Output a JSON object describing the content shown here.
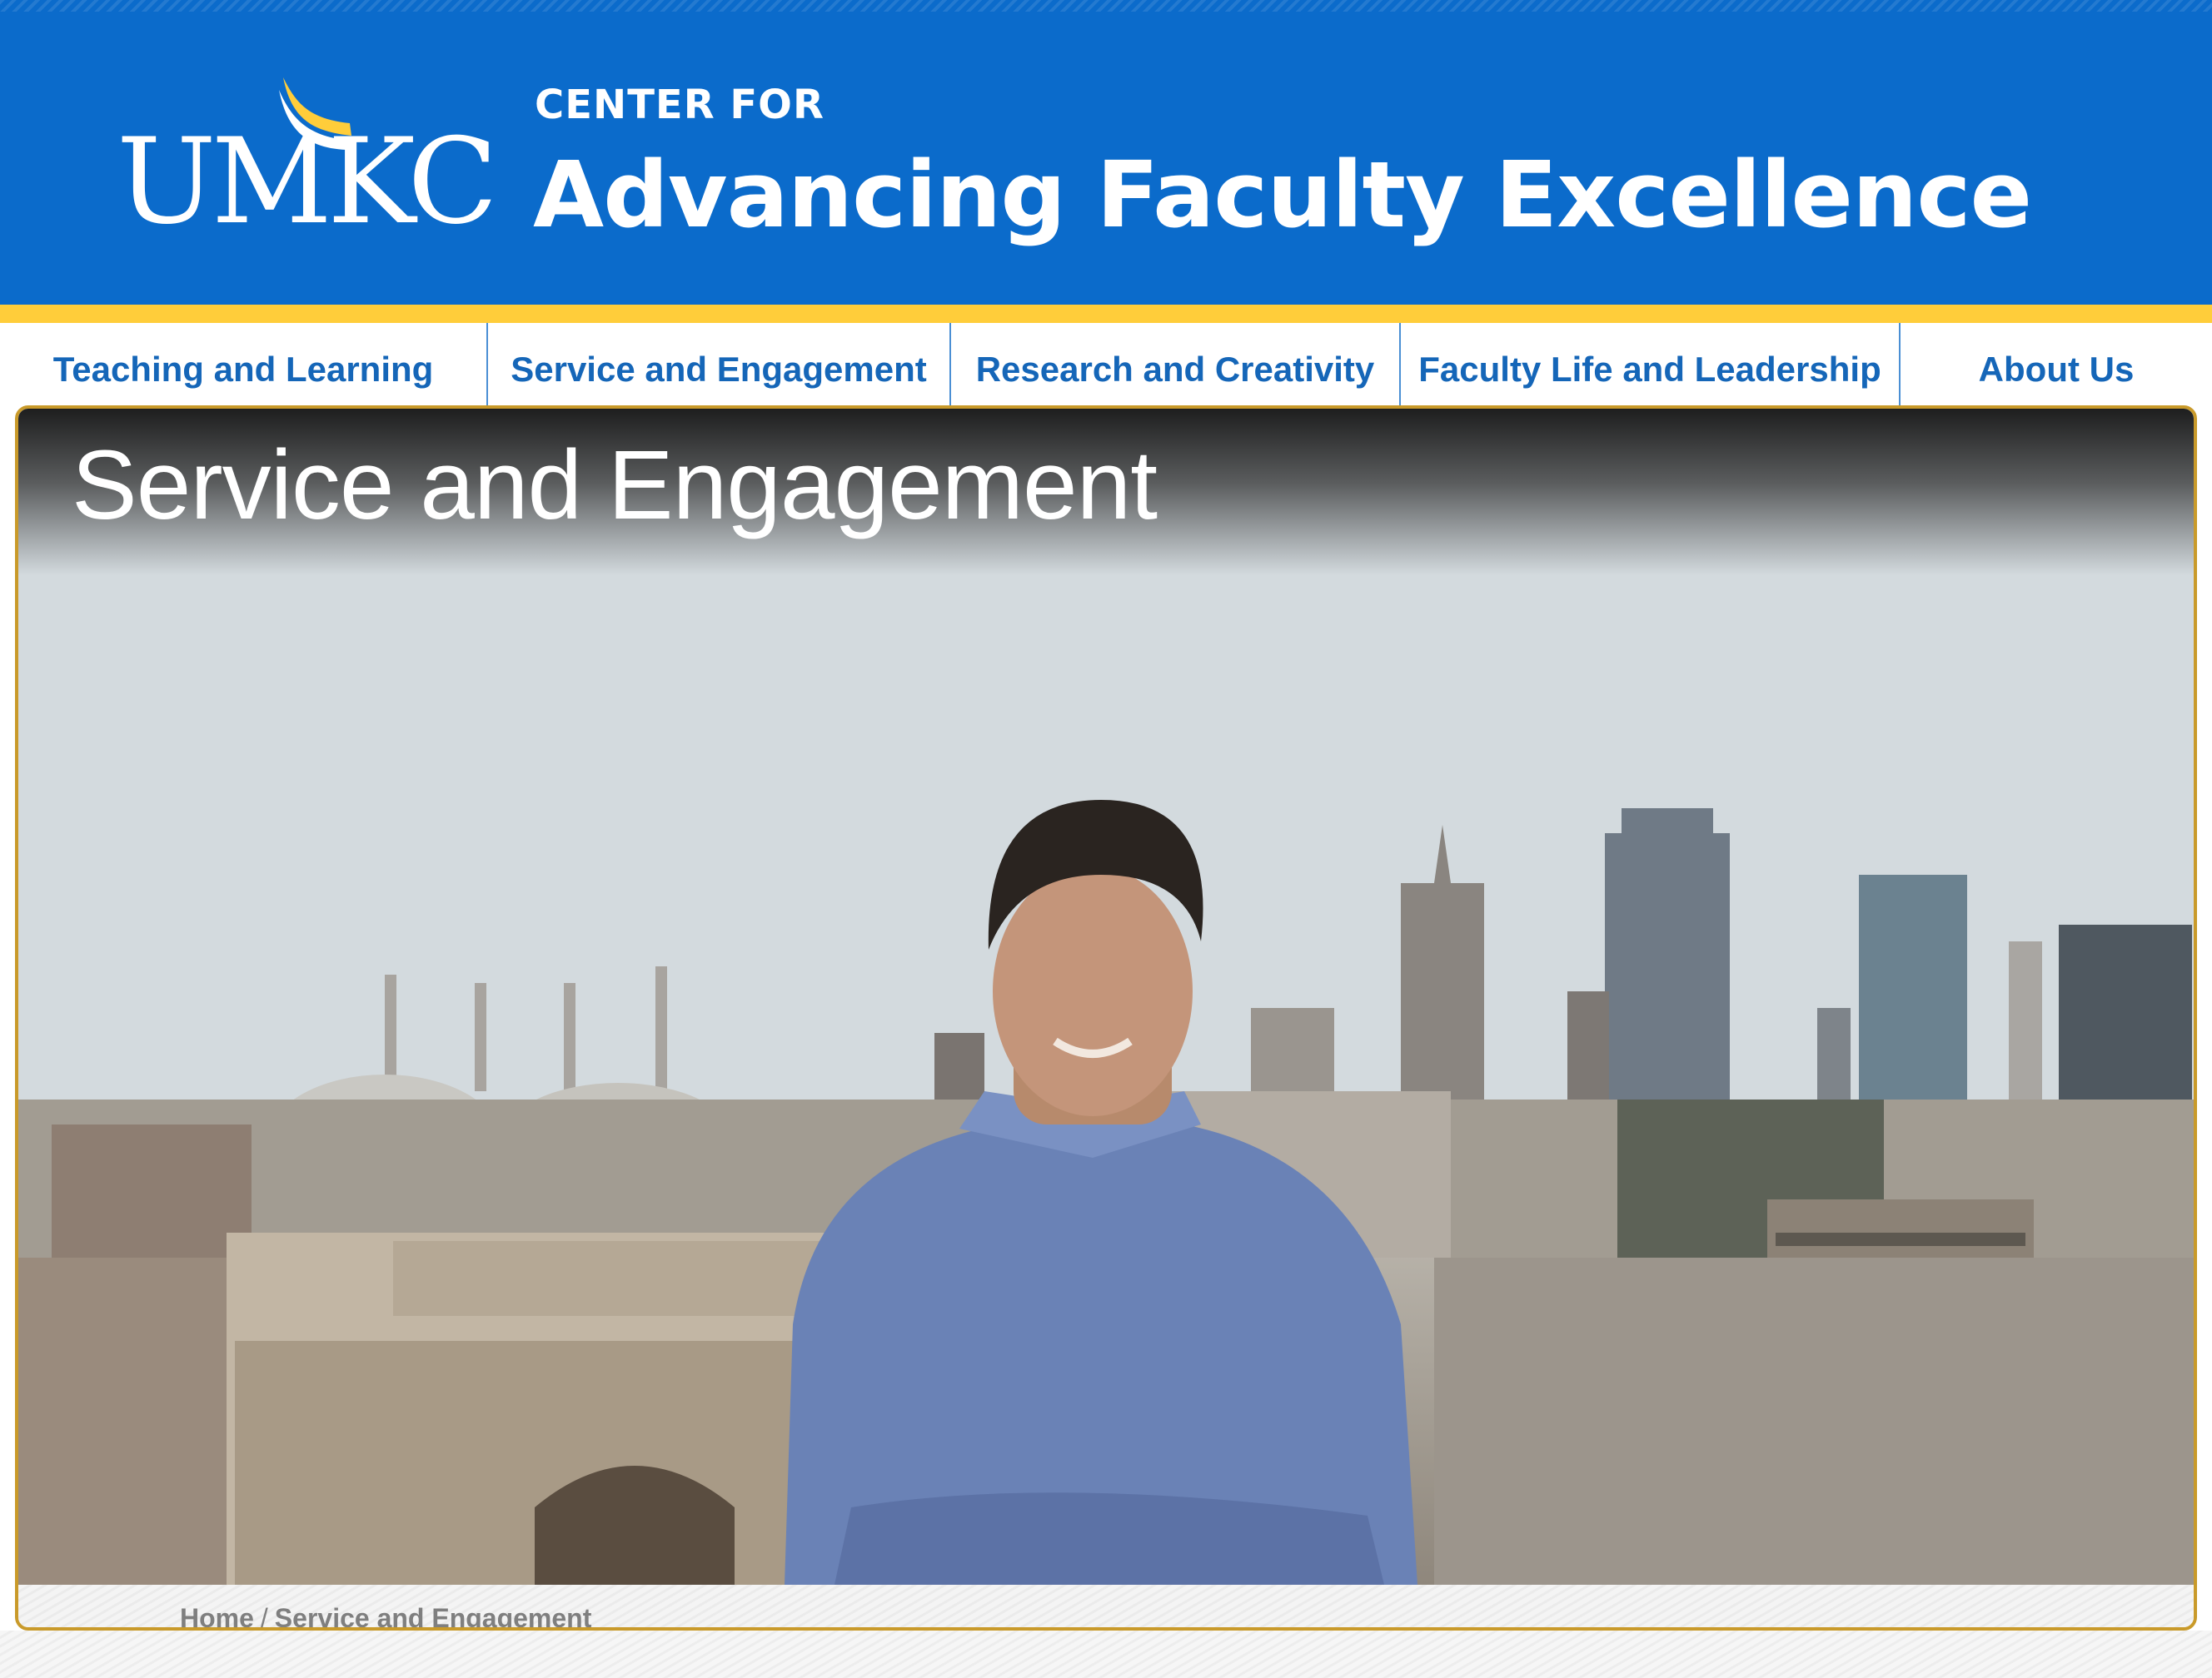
{
  "header": {
    "logo_text": "UMKC",
    "kicker": "CENTER FOR",
    "title": "Advancing Faculty Excellence"
  },
  "nav": {
    "items": [
      {
        "label": "Teaching and Learning"
      },
      {
        "label": "Service and Engagement"
      },
      {
        "label": "Research and Creativity"
      },
      {
        "label": "Faculty Life and Leadership"
      },
      {
        "label": "About Us"
      }
    ]
  },
  "hero": {
    "title": "Service and Engagement",
    "image_subject": "Student with arms crossed in front of a city skyline"
  },
  "breadcrumb": {
    "home": "Home",
    "separator": "/",
    "current": "Service and Engagement"
  },
  "colors": {
    "header_blue": "#0b6bcb",
    "gold": "#ffcd3a",
    "nav_text": "#1566b8",
    "frame": "#c99a2a"
  }
}
